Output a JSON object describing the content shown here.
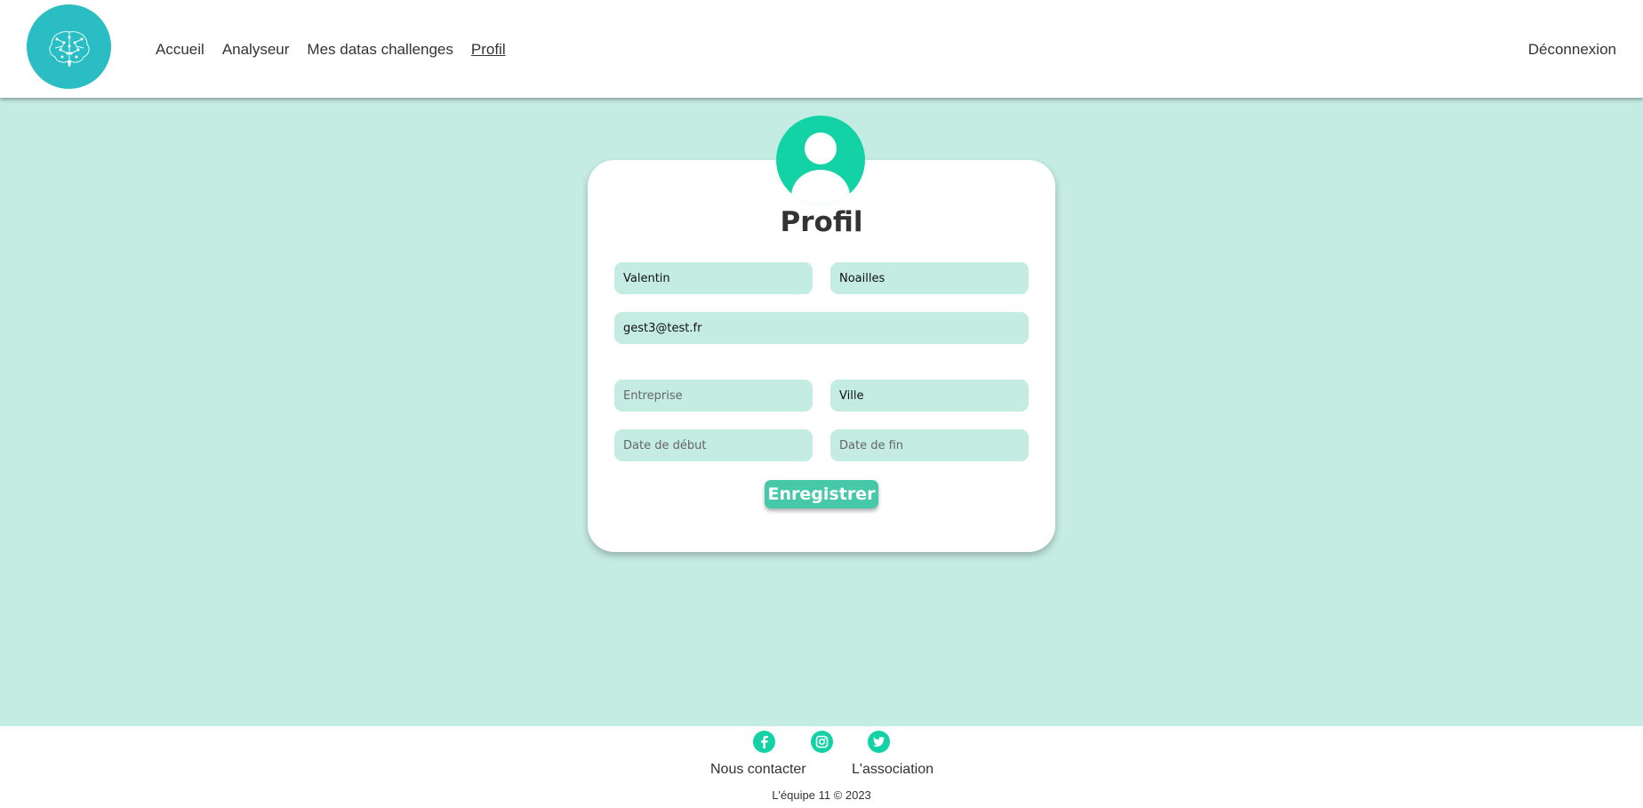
{
  "header": {
    "nav": [
      "Accueil",
      "Analyseur",
      "Mes datas challenges",
      "Profil"
    ],
    "logout_label": "Déconnexion"
  },
  "profile": {
    "title": "Profil",
    "first_name": {
      "value": "Valentin"
    },
    "last_name": {
      "value": "Noailles"
    },
    "email": {
      "value": "gest3@test.fr"
    },
    "company": {
      "value": "",
      "placeholder": "Entreprise"
    },
    "city": {
      "value": "Ville"
    },
    "start_date": {
      "value": "",
      "placeholder": "Date de début"
    },
    "end_date": {
      "value": "",
      "placeholder": "Date de fin"
    },
    "save_label": "Enregistrer"
  },
  "footer": {
    "social": [
      "facebook-icon",
      "instagram-icon",
      "twitter-icon"
    ],
    "contact_label": "Nous contacter",
    "association_label": "L'association",
    "copyright": "L'équipe 11 © 2023"
  },
  "colors": {
    "background": "#c4ece2",
    "accent": "#13d3a6",
    "logo": "#2bbdc4",
    "button": "#47c9a9"
  }
}
